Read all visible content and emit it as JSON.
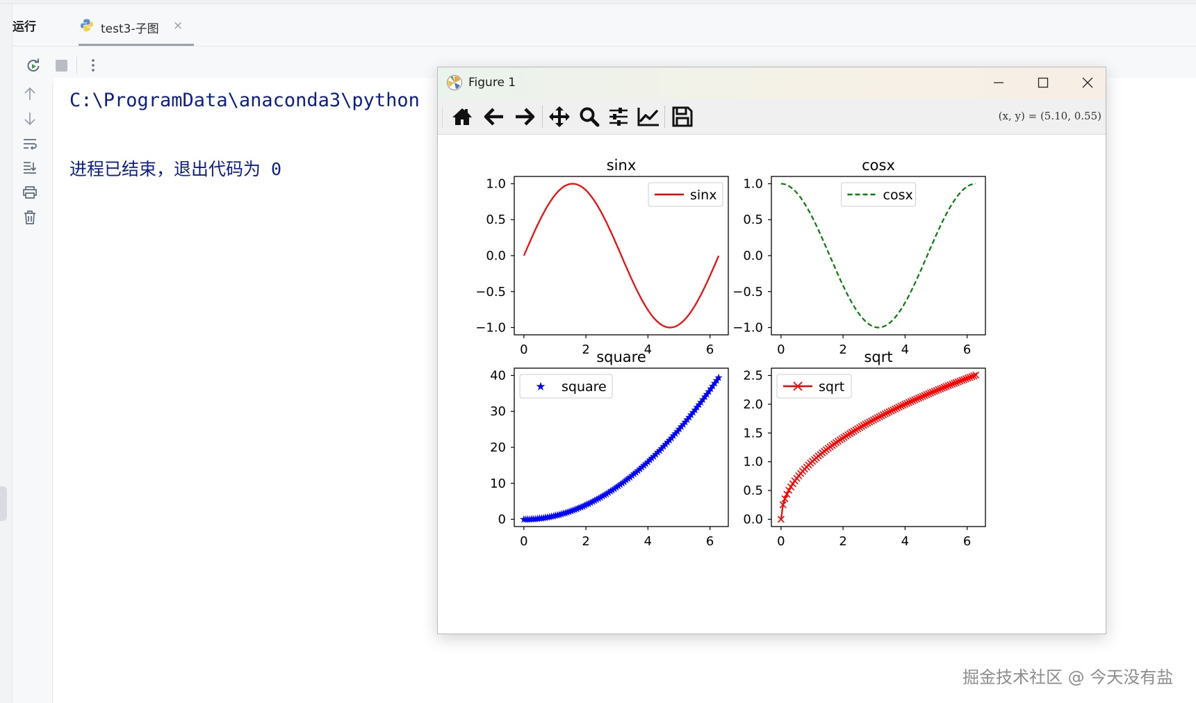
{
  "run_panel": {
    "label": "运行",
    "tab_label": "test3-子图",
    "tab_close": "×"
  },
  "console": {
    "line1": "C:\\ProgramData\\anaconda3\\python",
    "line2": "进程已结束，退出代码为 0"
  },
  "watermark": "掘金技术社区 @ 今天没有盐",
  "figure": {
    "window_title": "Figure 1",
    "coords_readout": "(x, y) = (5.10, 0.55)"
  },
  "colors": {
    "console_text": "#0b1e8f",
    "sin": "#ff0000",
    "cos": "#007f00",
    "square": "#0000ff",
    "sqrt": "#ff0000"
  },
  "chart_data": [
    {
      "type": "line",
      "title": "sinx",
      "legend": [
        "sinx"
      ],
      "legend_position": "top-right",
      "line_style": "solid",
      "color": "#ff0000",
      "function": "sin(x)",
      "x_range": [
        0,
        6.28
      ],
      "xlim": [
        0,
        6.28
      ],
      "ylim": [
        -1.0,
        1.0
      ],
      "x_ticks": [
        "0",
        "2",
        "4",
        "6"
      ],
      "y_ticks": [
        "−1.0",
        "−0.5",
        "0.0",
        "0.5",
        "1.0"
      ]
    },
    {
      "type": "line",
      "title": "cosx",
      "legend": [
        "cosx"
      ],
      "legend_position": "top-center",
      "line_style": "dashed",
      "color": "#007f00",
      "function": "cos(x)",
      "x_range": [
        0,
        6.28
      ],
      "xlim": [
        0,
        6.28
      ],
      "ylim": [
        -1.0,
        1.0
      ],
      "x_ticks": [
        "0",
        "2",
        "4",
        "6"
      ],
      "y_ticks": [
        "−1.0",
        "−0.5",
        "0.0",
        "0.5",
        "1.0"
      ]
    },
    {
      "type": "scatter",
      "title": "square",
      "legend": [
        "square"
      ],
      "legend_position": "top-left",
      "marker": "star",
      "color": "#0000ff",
      "function": "x^2",
      "x_range": [
        0,
        6.28
      ],
      "xlim": [
        0,
        6.28
      ],
      "ylim": [
        0,
        40
      ],
      "x_ticks": [
        "0",
        "2",
        "4",
        "6"
      ],
      "y_ticks": [
        "0",
        "10",
        "20",
        "30",
        "40"
      ]
    },
    {
      "type": "line",
      "title": "sqrt",
      "legend": [
        "sqrt"
      ],
      "legend_position": "top-left",
      "marker": "x",
      "color": "#ff0000",
      "function": "sqrt(x)",
      "x_range": [
        0,
        6.28
      ],
      "xlim": [
        0,
        6.28
      ],
      "ylim": [
        0,
        2.5
      ],
      "x_ticks": [
        "0",
        "2",
        "4",
        "6"
      ],
      "y_ticks": [
        "0.0",
        "0.5",
        "1.0",
        "1.5",
        "2.0",
        "2.5"
      ]
    }
  ]
}
